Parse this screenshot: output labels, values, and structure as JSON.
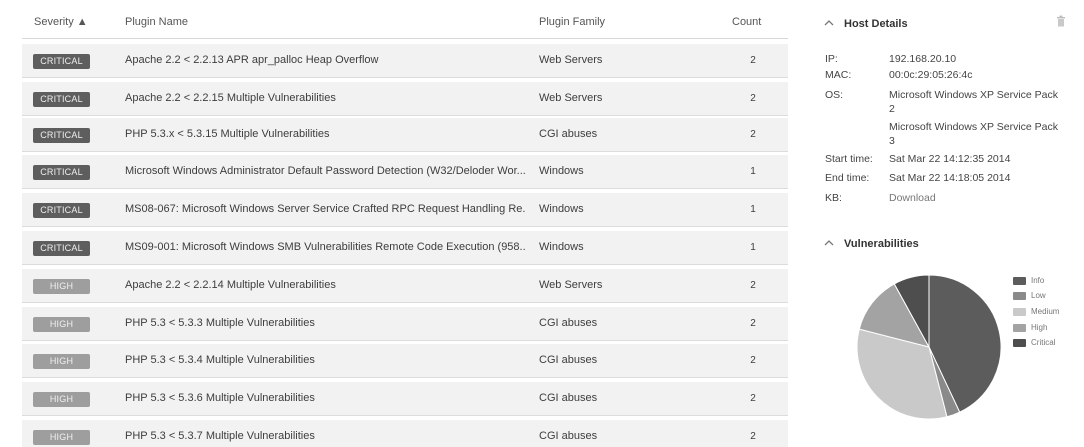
{
  "table": {
    "headers": {
      "severity": "Severity ▲",
      "plugin_name": "Plugin Name",
      "plugin_family": "Plugin Family",
      "count": "Count"
    },
    "rows": [
      {
        "severity": "CRITICAL",
        "name": "Apache 2.2 < 2.2.13 APR apr_palloc Heap Overflow",
        "family": "Web Servers",
        "count": "2"
      },
      {
        "severity": "CRITICAL",
        "name": "Apache 2.2 < 2.2.15 Multiple Vulnerabilities",
        "family": "Web Servers",
        "count": "2"
      },
      {
        "severity": "CRITICAL",
        "name": "PHP 5.3.x < 5.3.15 Multiple Vulnerabilities",
        "family": "CGI abuses",
        "count": "2"
      },
      {
        "severity": "CRITICAL",
        "name": "Microsoft Windows Administrator Default Password Detection (W32/Deloder Wor...",
        "family": "Windows",
        "count": "1"
      },
      {
        "severity": "CRITICAL",
        "name": "MS08-067: Microsoft Windows Server Service Crafted RPC Request Handling Re...",
        "family": "Windows",
        "count": "1"
      },
      {
        "severity": "CRITICAL",
        "name": "MS09-001: Microsoft Windows SMB Vulnerabilities Remote Code Execution (958...",
        "family": "Windows",
        "count": "1"
      },
      {
        "severity": "HIGH",
        "name": "Apache 2.2 < 2.2.14 Multiple Vulnerabilities",
        "family": "Web Servers",
        "count": "2"
      },
      {
        "severity": "HIGH",
        "name": "PHP 5.3 < 5.3.3 Multiple Vulnerabilities",
        "family": "CGI abuses",
        "count": "2"
      },
      {
        "severity": "HIGH",
        "name": "PHP 5.3 < 5.3.4 Multiple Vulnerabilities",
        "family": "CGI abuses",
        "count": "2"
      },
      {
        "severity": "HIGH",
        "name": "PHP 5.3 < 5.3.6 Multiple Vulnerabilities",
        "family": "CGI abuses",
        "count": "2"
      },
      {
        "severity": "HIGH",
        "name": "PHP 5.3 < 5.3.7 Multiple Vulnerabilities",
        "family": "CGI abuses",
        "count": "2"
      }
    ]
  },
  "host_details": {
    "title": "Host Details",
    "chevron_icon": "chevron-up-icon",
    "delete_icon": "trash-icon",
    "ip_label": "IP:",
    "ip": "192.168.20.10",
    "mac_label": "MAC:",
    "mac": "00:0c:29:05:26:4c",
    "os_label": "OS:",
    "os_1a": "Microsoft Windows XP Service Pack",
    "os_1b": "2",
    "os_2a": "Microsoft Windows XP Service Pack",
    "os_2b": "3",
    "start_label": "Start time:",
    "start": "Sat Mar 22 14:12:35 2014",
    "end_label": "End time:",
    "end": "Sat Mar 22 14:18:05 2014",
    "kb_label": "KB:",
    "kb": "Download"
  },
  "vulnerabilities": {
    "title": "Vulnerabilities",
    "chevron_icon": "chevron-up-icon",
    "legend": [
      {
        "label": "Info",
        "color": "#5c5c5c"
      },
      {
        "label": "Low",
        "color": "#8a8a8a"
      },
      {
        "label": "Medium",
        "color": "#c9c9c9"
      },
      {
        "label": "High",
        "color": "#a3a3a3"
      },
      {
        "label": "Critical",
        "color": "#4e4e4e"
      }
    ]
  },
  "colors": {
    "critical_badge": "#5e5e5e",
    "high_badge": "#9e9e9e",
    "row_bg": "#f2f2f2",
    "side_panel_bg": "#f7f7f7"
  },
  "chart_data": {
    "type": "pie",
    "categories": [
      "Info",
      "Low",
      "Medium",
      "High",
      "Critical"
    ],
    "values": [
      43,
      3,
      33,
      13,
      8
    ],
    "colors": [
      "#5c5c5c",
      "#8a8a8a",
      "#c9c9c9",
      "#a3a3a3",
      "#4e4e4e"
    ],
    "legend": "right"
  }
}
